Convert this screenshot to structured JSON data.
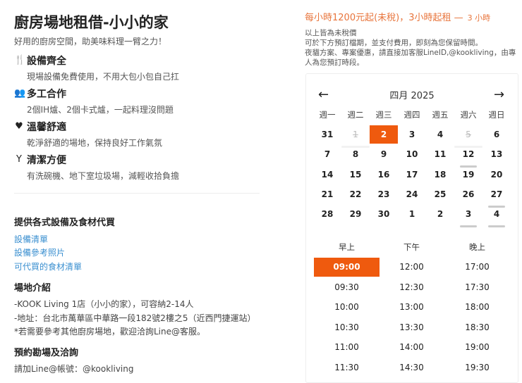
{
  "title": "廚房場地租借-小小的家",
  "subtitle": "好用的廚房空間，助美味料理一臂之力！",
  "features": [
    {
      "icon": "utensils-icon",
      "glyph": "🍴",
      "title": "設備齊全",
      "desc": "現場設備免費使用，不用大包小包自己扛"
    },
    {
      "icon": "users-icon",
      "glyph": "👥",
      "title": "多工合作",
      "desc": "2個IH爐、2個卡式爐，一起料理沒問題"
    },
    {
      "icon": "heart-icon",
      "glyph": "♥",
      "title": "溫馨舒適",
      "desc": "乾淨舒適的場地，保持良好工作氣氛"
    },
    {
      "icon": "glass-icon",
      "glyph": "Y",
      "title": "清潔方便",
      "desc": "有洗碗機、地下室垃圾場，減輕收拾負擔"
    }
  ],
  "equipment": {
    "heading": "提供各式設備及食材代買",
    "links": [
      "設備清單",
      "設備參考照片",
      "可代買的食材清單"
    ]
  },
  "venue": {
    "heading": "場地介紹",
    "lines": [
      "-KOOK Living 1店（小小的家），可容納2-14人",
      "-地址：台北市萬華區中華路一段182號2樓之5（近西門捷運站）",
      "*若需要參考其他廚房場地，歡迎洽詢Line@客服。"
    ]
  },
  "booking": {
    "heading": "預約勘場及洽詢",
    "line": "請加Line@帳號：@kookliving"
  },
  "price": {
    "text": "每小時1200元起(未稅)，3小時起租 —",
    "duration": "3 小時"
  },
  "notes": [
    "以上皆為未稅價",
    "可於下方預訂檔期，並支付費用，即刻為您保留時間。",
    "夜貓方案、專案優惠，請直接加客服LineID,@kookliving，由專人為您預訂時段。"
  ],
  "calendar": {
    "prev": "←",
    "next": "→",
    "month": "四月 2025",
    "weekdays": [
      "週一",
      "週二",
      "週三",
      "週四",
      "週五",
      "週六",
      "週日"
    ],
    "weeks": [
      [
        {
          "d": "31"
        },
        {
          "d": "1",
          "disabled": true,
          "bar": true
        },
        {
          "d": "2",
          "selected": true
        },
        {
          "d": "3"
        },
        {
          "d": "4"
        },
        {
          "d": "5",
          "disabled": true,
          "bar": true
        },
        {
          "d": "6"
        }
      ],
      [
        {
          "d": "7"
        },
        {
          "d": "8"
        },
        {
          "d": "9"
        },
        {
          "d": "10"
        },
        {
          "d": "11"
        },
        {
          "d": "12",
          "bar": true
        },
        {
          "d": "13"
        }
      ],
      [
        {
          "d": "14"
        },
        {
          "d": "15"
        },
        {
          "d": "16"
        },
        {
          "d": "17"
        },
        {
          "d": "18"
        },
        {
          "d": "19"
        },
        {
          "d": "20"
        }
      ],
      [
        {
          "d": "21"
        },
        {
          "d": "22"
        },
        {
          "d": "23"
        },
        {
          "d": "24"
        },
        {
          "d": "25"
        },
        {
          "d": "26"
        },
        {
          "d": "27",
          "bar": true
        }
      ],
      [
        {
          "d": "28"
        },
        {
          "d": "29"
        },
        {
          "d": "30"
        },
        {
          "d": "1"
        },
        {
          "d": "2"
        },
        {
          "d": "3",
          "bar": true
        },
        {
          "d": "4",
          "bar": true
        }
      ]
    ]
  },
  "times": {
    "headers": [
      "早上",
      "下午",
      "晚上"
    ],
    "columns": [
      [
        "09:00",
        "09:30",
        "10:00",
        "10:30",
        "11:00",
        "11:30"
      ],
      [
        "12:00",
        "12:30",
        "13:00",
        "13:30",
        "14:00",
        "14:30"
      ],
      [
        "17:00",
        "17:30",
        "18:00",
        "18:30",
        "19:00",
        "19:30"
      ]
    ],
    "selected": "09:00"
  },
  "colors": {
    "accent": "#ef5a0e",
    "price": "#e8743b",
    "link": "#3a8fd0"
  }
}
